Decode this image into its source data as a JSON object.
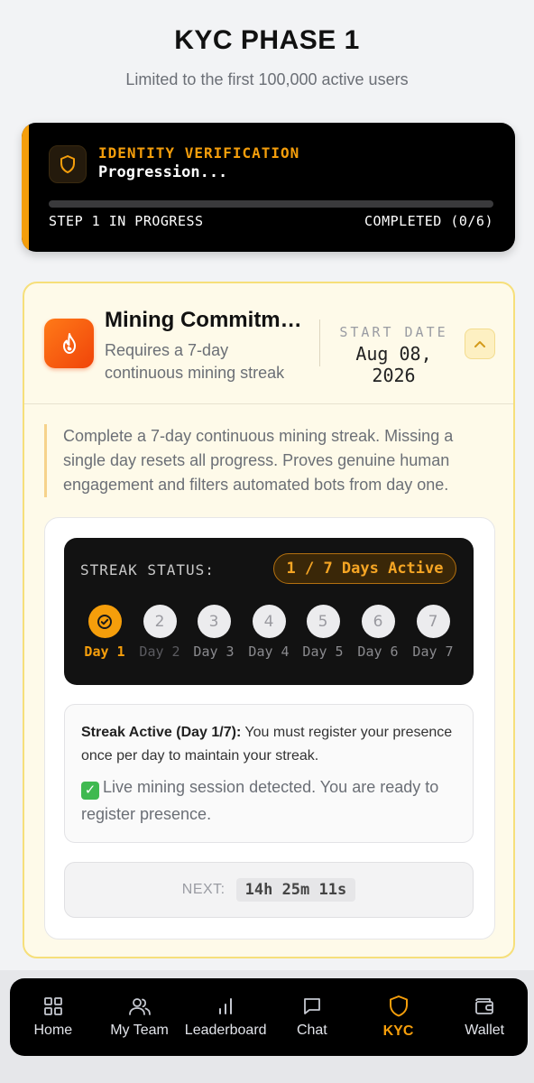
{
  "header": {
    "title": "KYC PHASE 1",
    "subtitle": "Limited to the first 100,000 active users"
  },
  "identity": {
    "label": "IDENTITY VERIFICATION",
    "status": "Progression...",
    "step_text": "STEP 1 IN PROGRESS",
    "completed_text": "COMPLETED (0/6)",
    "progress": 0,
    "icon": "shield-icon"
  },
  "mining": {
    "title": "Mining Commitme...",
    "description": "Requires a 7-day continuous mining streak",
    "start_label": "START DATE",
    "start_date": "Aug 08, 2026",
    "body": "Complete a 7-day continuous mining streak. Missing a single day resets all progress. Proves genuine human engagement and filters automated bots from day one.",
    "streak": {
      "label": "STREAK STATUS:",
      "badge": "1 / 7 Days Active",
      "days": [
        {
          "num": "",
          "label": "Day 1",
          "state": "done"
        },
        {
          "num": "2",
          "label": "Day 2",
          "state": "dim"
        },
        {
          "num": "3",
          "label": "Day 3",
          "state": "pending"
        },
        {
          "num": "4",
          "label": "Day 4",
          "state": "pending"
        },
        {
          "num": "5",
          "label": "Day 5",
          "state": "pending"
        },
        {
          "num": "6",
          "label": "Day 6",
          "state": "pending"
        },
        {
          "num": "7",
          "label": "Day 7",
          "state": "pending"
        }
      ]
    },
    "info": {
      "bold": "Streak Active (Day 1/7):",
      "text": " You must register your presence once per day to maintain your streak.",
      "status": "Live mining session detected. You are ready to register presence."
    },
    "next": {
      "label": "NEXT:",
      "value": "14h 25m 11s"
    }
  },
  "nav": {
    "items": [
      {
        "label": "Home",
        "icon": "home-grid-icon"
      },
      {
        "label": "My Team",
        "icon": "team-icon"
      },
      {
        "label": "Leaderboard",
        "icon": "leaderboard-icon"
      },
      {
        "label": "Chat",
        "icon": "chat-icon"
      },
      {
        "label": "KYC",
        "icon": "shield-icon",
        "active": true
      },
      {
        "label": "Wallet",
        "icon": "wallet-icon"
      }
    ]
  },
  "colors": {
    "accent": "#f59e0b",
    "fire": "#f0440a"
  }
}
